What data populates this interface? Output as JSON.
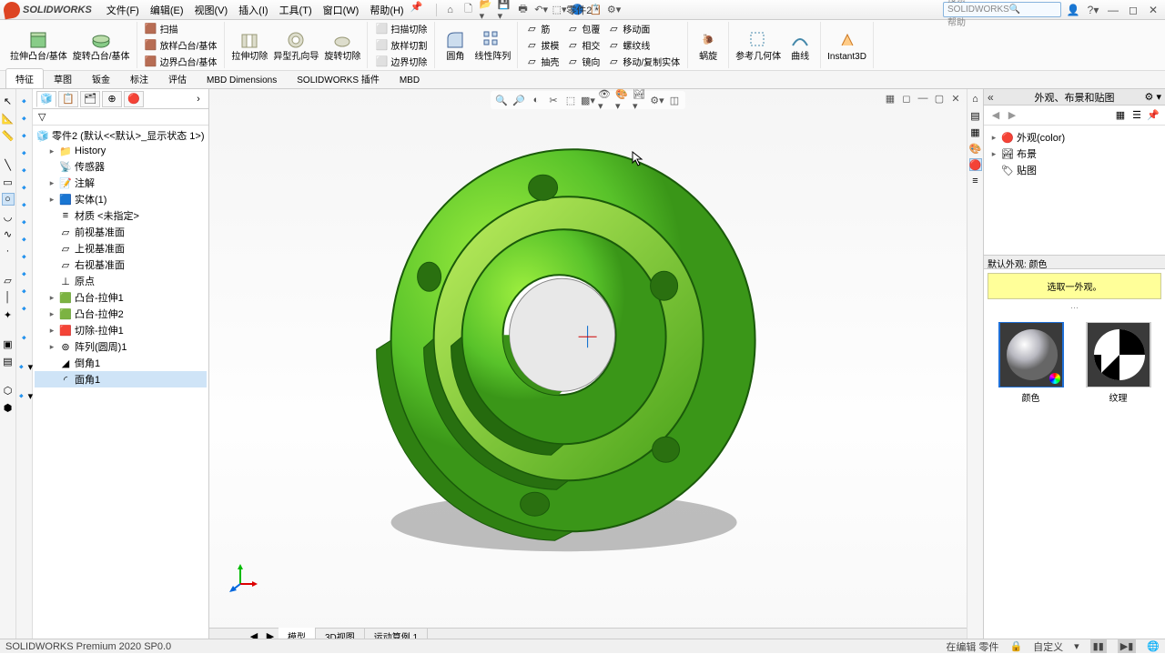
{
  "app": {
    "logo_text": "SOLIDWORKS"
  },
  "doc": {
    "name": "零件2 *"
  },
  "menus": [
    "文件(F)",
    "编辑(E)",
    "视图(V)",
    "插入(I)",
    "工具(T)",
    "窗口(W)",
    "帮助(H)"
  ],
  "search": {
    "placeholder": "搜索 SOLIDWORKS 帮助"
  },
  "ribbon": {
    "g1a": "拉伸凸台/基体",
    "g1b": "旋转凸台/基体",
    "g2": [
      "扫描",
      "放样凸台/基体",
      "边界凸台/基体"
    ],
    "g3a": "拉伸切除",
    "g3b": "异型孔向导",
    "g3c": "旋转切除",
    "g4": [
      "扫描切除",
      "放样切割",
      "边界切除"
    ],
    "g5a": "圆角",
    "g5b": "线性阵列",
    "g6": [
      "筋",
      "拔模",
      "抽壳",
      "包覆",
      "相交",
      "镜向"
    ],
    "g7": [
      "移动面",
      "移动/复制实体"
    ],
    "curv": "曲线",
    "g8a": "参考几何体",
    "g8b": "曲线",
    "snail": "蜗旋",
    "instant3d": "Instant3D"
  },
  "cmdtabs": [
    "特征",
    "草图",
    "钣金",
    "标注",
    "评估",
    "MBD Dimensions",
    "SOLIDWORKS 插件",
    "MBD"
  ],
  "tree": {
    "root": "零件2 (默认<<默认>_显示状态 1>)",
    "items": [
      "History",
      "传感器",
      "注解",
      "实体(1)",
      "材质 <未指定>",
      "前视基准面",
      "上视基准面",
      "右视基准面",
      "原点",
      "凸台-拉伸1",
      "凸台-拉伸2",
      "切除-拉伸1",
      "阵列(圆周)1",
      "倒角1",
      "面角1"
    ]
  },
  "bottomtabs": [
    "模型",
    "3D视图",
    "运动算例 1"
  ],
  "rightpanel": {
    "title": "外观、布景和贴图",
    "items": [
      "外观(color)",
      "布景",
      "贴图"
    ],
    "section": "默认外观: 颜色",
    "hint": "选取一外观。",
    "sw1": "颜色",
    "sw2": "纹理"
  },
  "status": {
    "left": "SOLIDWORKS Premium 2020 SP0.0",
    "r1": "在编辑 零件",
    "r2": "自定义"
  }
}
